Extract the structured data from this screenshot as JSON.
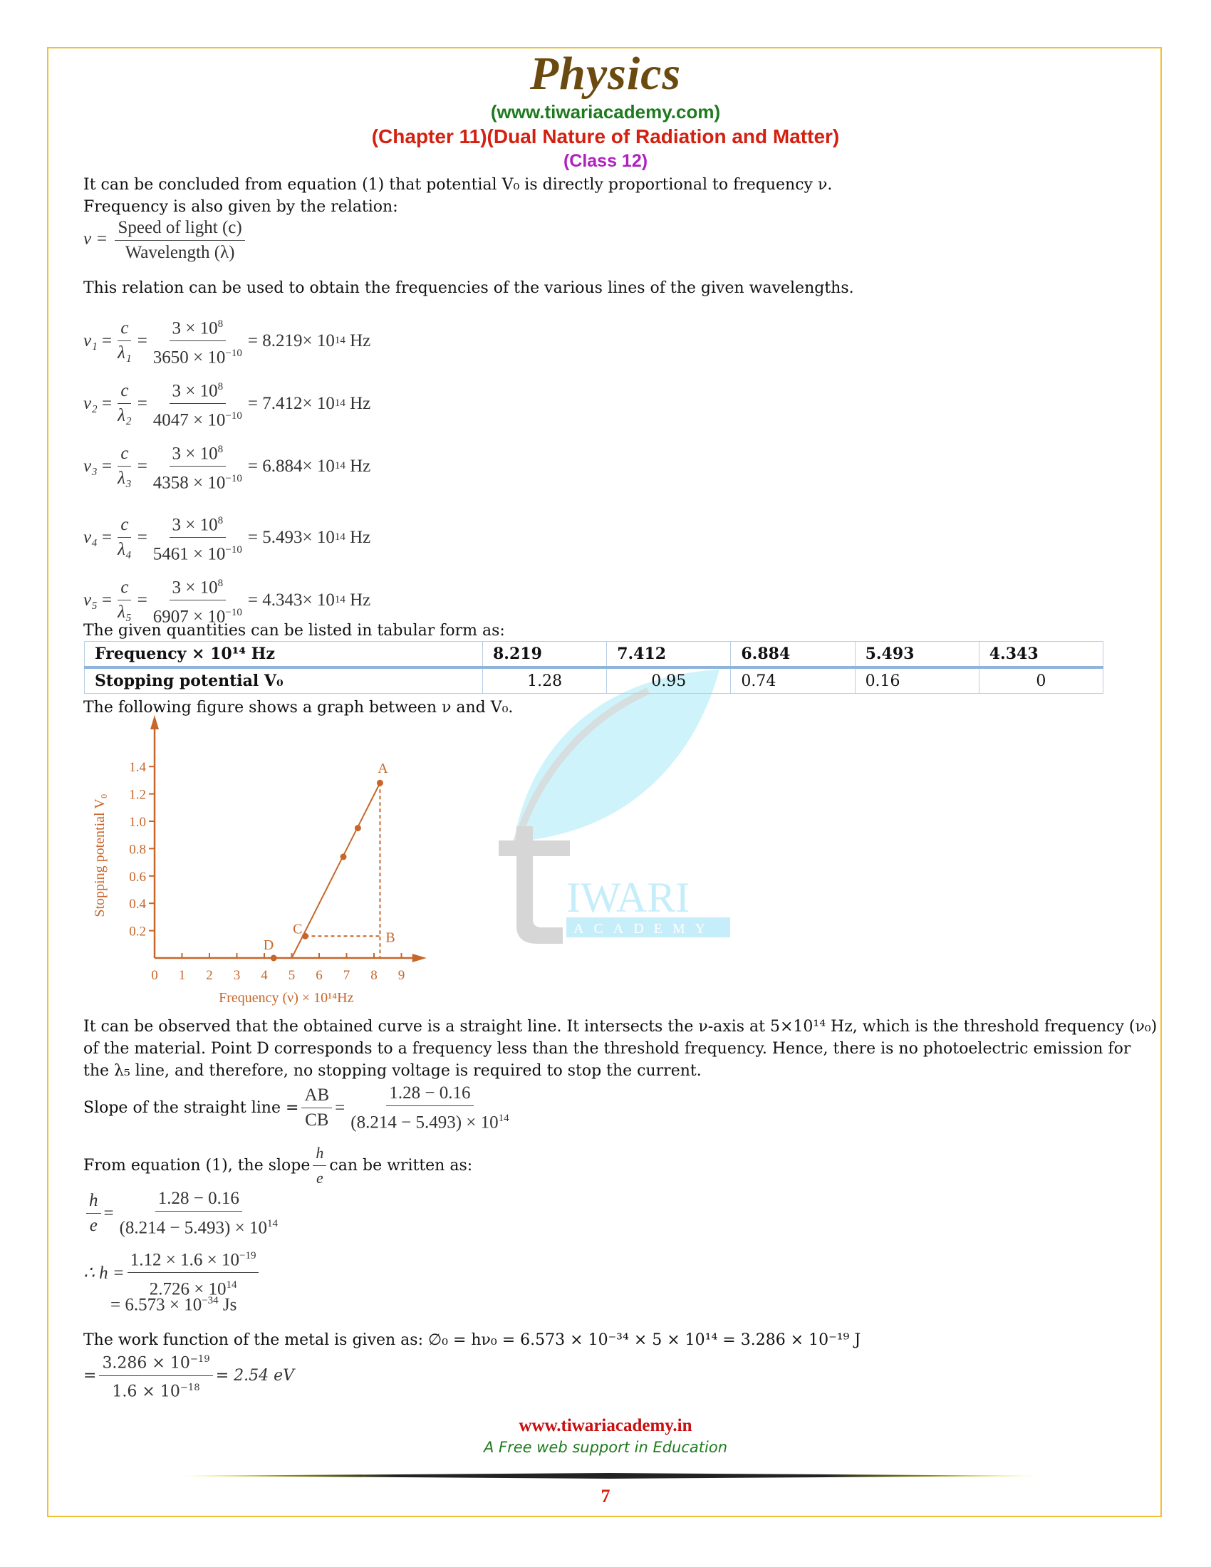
{
  "header": {
    "title": "Physics",
    "website": "(www.tiwariacademy.com)",
    "chapter": "(Chapter 11)(Dual Nature of Radiation and Matter)",
    "class": "(Class 12)"
  },
  "intro": {
    "line1": "It can be concluded from equation (1) that potential V₀ is directly proportional to frequency ν.",
    "line2": "Frequency is also given by the relation:",
    "relation": {
      "lhs": "ν =",
      "numerator": "Speed of light (c)",
      "denominator": "Wavelength (λ)"
    },
    "line3": "This relation can be used to obtain the frequencies of the various lines of the given wavelengths."
  },
  "equations": [
    {
      "lhs": "ν₁",
      "sym": "λ₁",
      "wavelength": "3650",
      "result": "8.219"
    },
    {
      "lhs": "ν₂",
      "sym": "λ₂",
      "wavelength": "4047",
      "result": "7.412"
    },
    {
      "lhs": "ν₃",
      "sym": "λ₃",
      "wavelength": "4358",
      "result": "6.884"
    },
    {
      "lhs": "ν₄",
      "sym": "λ₄",
      "wavelength": "5461",
      "result": "5.493"
    },
    {
      "lhs": "ν₅",
      "sym": "λ₅",
      "wavelength": "6907",
      "result": "4.343"
    }
  ],
  "equation_parts": {
    "c": "c",
    "numerator": "3 × 10",
    "num_exp": "8",
    "den_suffix": " × 10",
    "den_exp": "−10",
    "res_suffix": " × 10",
    "res_exp": "14",
    "unit": "Hz"
  },
  "table_intro": "The given quantities can be listed in tabular form as:",
  "table": {
    "rows": [
      {
        "label": "Frequency × 10¹⁴ Hz",
        "values": [
          "8.219",
          "7.412",
          "6.884",
          "5.493",
          "4.343"
        ]
      },
      {
        "label": "Stopping potential V₀",
        "values": [
          "1.28",
          "0.95",
          "0.74",
          "0.16",
          "0"
        ]
      }
    ]
  },
  "graph_intro": "The following figure shows a graph between ν and V₀.",
  "chart_data": {
    "type": "scatter",
    "title": "",
    "xlabel": "Frequency (ν) × 10¹⁴Hz",
    "ylabel": "Stopping potential V₀",
    "xlim": [
      0,
      9.5
    ],
    "ylim": [
      0,
      1.5
    ],
    "xticks": [
      "0",
      "1",
      "2",
      "3",
      "4",
      "5",
      "6",
      "7",
      "8",
      "9"
    ],
    "yticks": [
      "0.2",
      "0.4",
      "0.6",
      "0.8",
      "1.0",
      "1.2",
      "1.4"
    ],
    "points": [
      {
        "x": 4.343,
        "y": 0,
        "label": "D"
      },
      {
        "x": 5.493,
        "y": 0.16,
        "label": "C"
      },
      {
        "x": 6.884,
        "y": 0.74,
        "label": ""
      },
      {
        "x": 7.412,
        "y": 0.95,
        "label": ""
      },
      {
        "x": 8.219,
        "y": 1.28,
        "label": "A"
      }
    ],
    "fit_line": {
      "x_intercept": 5.0,
      "end": {
        "x": 8.219,
        "y": 1.28
      }
    },
    "annotations": [
      {
        "label": "B",
        "x": 8.219,
        "y": 0.16
      }
    ],
    "grid": false,
    "color": "#c8662a"
  },
  "observation": {
    "line1": "It can be observed that the obtained curve is a straight line. It intersects the ν-axis at 5×10¹⁴ Hz, which is the threshold frequency (ν₀)",
    "line2": "of the material. Point D corresponds to a frequency less than the threshold frequency. Hence, there is no photoelectric emission for",
    "line3": "the λ₅ line, and therefore, no stopping voltage is required to stop the current."
  },
  "slope": {
    "label": "Slope of the straight line =",
    "ab": "AB",
    "cb": "CB",
    "numerator": "1.28 − 0.16",
    "denominator": "(8.214 − 5.493) × 10",
    "den_exp": "14"
  },
  "planck": {
    "intro_pre": "From equation (1), the slope",
    "intro_post": "can be written as:",
    "h": "h",
    "e": "e",
    "step1_num": "1.28 − 0.16",
    "step1_den": "(8.214 − 5.493) × 10",
    "step1_exp": "14",
    "step2_lhs": "∴ h =",
    "step2_num": "1.12 × 1.6 × 10",
    "step2_num_exp": "−19",
    "step2_den": "2.726 × 10",
    "step2_den_exp": "14",
    "result": "= 6.573 × 10",
    "result_exp": "−34",
    "result_unit": "Js"
  },
  "work_function": {
    "line": "The work function of the metal is given as: ∅₀ = hν₀ = 6.573 × 10⁻³⁴ × 5 × 10¹⁴ = 3.286 × 10⁻¹⁹ J",
    "num": "3.286 × 10",
    "num_exp": "−19",
    "den": "1.6 × 10",
    "den_exp": "−18",
    "result": "= 2.54 eV"
  },
  "watermark": {
    "word": "IWARI",
    "sub": "ACADEMY"
  },
  "footer": {
    "website": "www.tiwariacademy.in",
    "tagline": "A Free web support in Education",
    "page_number": "7"
  }
}
